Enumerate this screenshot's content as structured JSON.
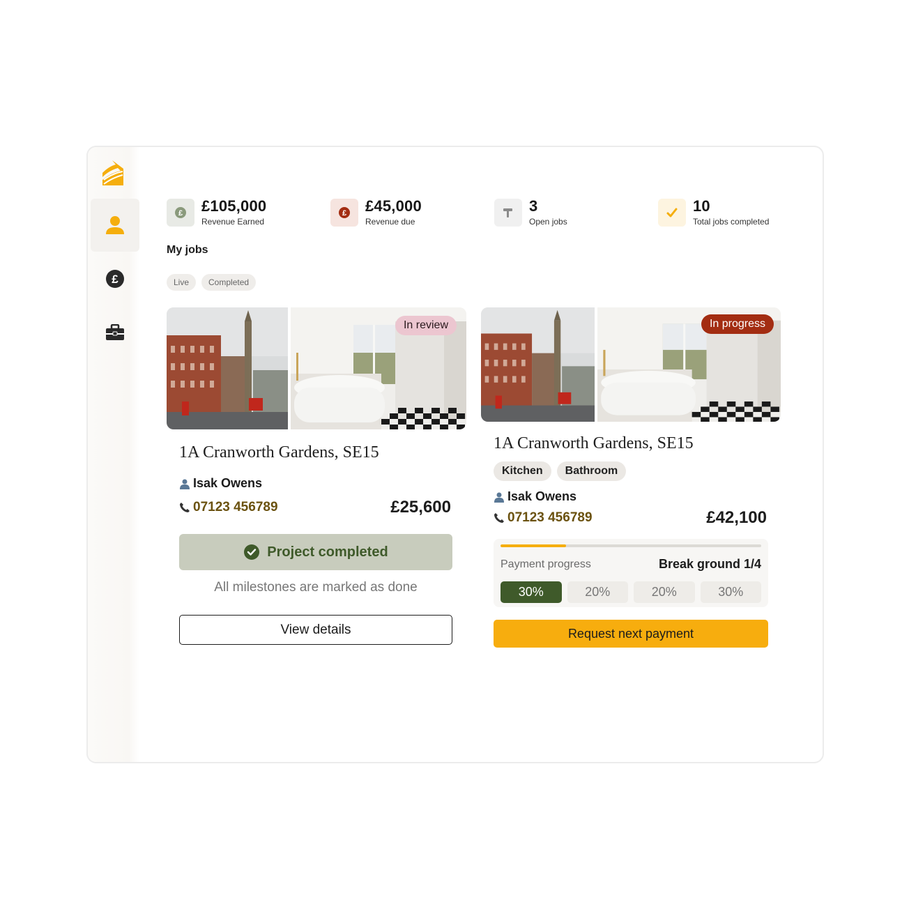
{
  "nav": {
    "items": [
      {
        "icon": "person-icon",
        "active": true
      },
      {
        "icon": "pound-circle-icon",
        "active": false
      },
      {
        "icon": "briefcase-icon",
        "active": false
      }
    ]
  },
  "stats": [
    {
      "value": "£105,000",
      "label": "Revenue Earned",
      "icon": "pound-coin-icon"
    },
    {
      "value": "£45,000",
      "label": "Revenue due",
      "icon": "pound-coin-icon"
    },
    {
      "value": "3",
      "label": "Open jobs",
      "icon": "hammer-icon"
    },
    {
      "value": "10",
      "label": "Total jobs completed",
      "icon": "check-icon"
    }
  ],
  "section_title": "My jobs",
  "filters": [
    "Live",
    "Completed"
  ],
  "jobs": [
    {
      "status": "In review",
      "address": "1A Cranworth Gardens, SE15",
      "customer": "Isak Owens",
      "phone": "07123 456789",
      "amount": "£25,600",
      "completed_label": "Project completed",
      "completed_note": "All milestones are marked as done",
      "action": "View details"
    },
    {
      "status": "In progress",
      "address": "1A Cranworth Gardens, SE15",
      "tags": [
        "Kitchen",
        "Bathroom"
      ],
      "customer": "Isak Owens",
      "phone": "07123 456789",
      "amount": "£42,100",
      "payment_label": "Payment progress",
      "payment_stage": "Break ground 1/4",
      "payment_progress": 0.25,
      "milestones": [
        "30%",
        "20%",
        "20%",
        "30%"
      ],
      "action": "Request next payment"
    }
  ],
  "colors": {
    "accent": "#f7ad0e",
    "success": "#3f5a2a",
    "review": "#ecc6d0",
    "in_progress": "#a32d12"
  }
}
